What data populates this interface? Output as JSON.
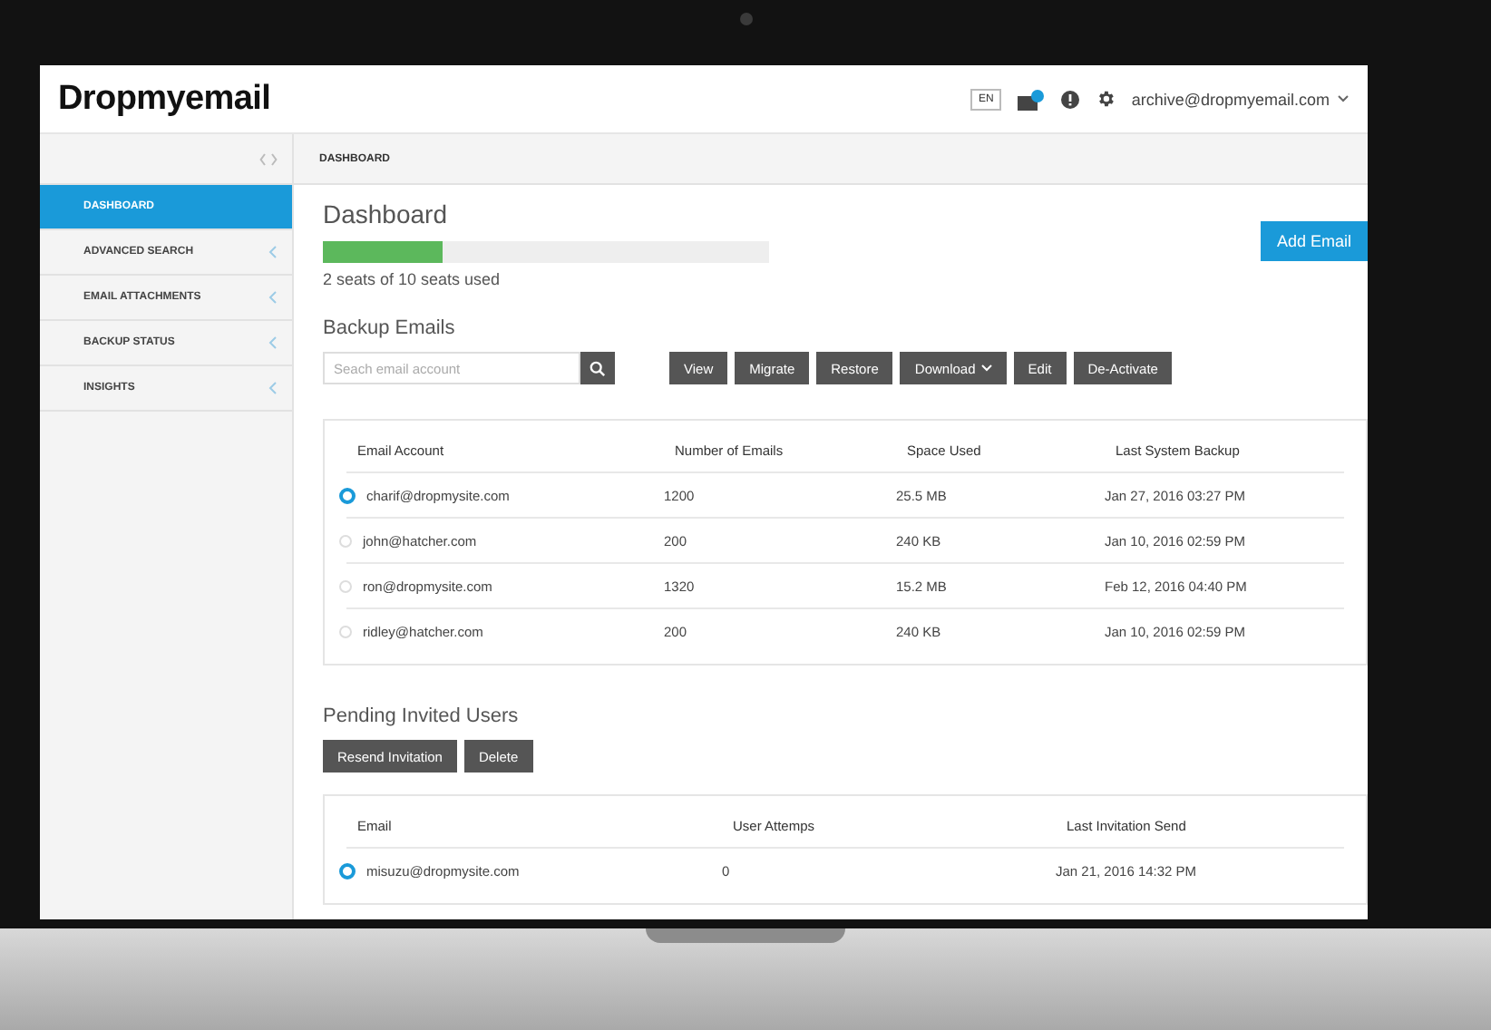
{
  "header": {
    "logo": "Dropmyemail",
    "language": "EN",
    "account": "archive@dropmyemail.com"
  },
  "sidebar": {
    "items": [
      {
        "label": "DASHBOARD",
        "selected": true,
        "expandable": false
      },
      {
        "label": "ADVANCED SEARCH",
        "selected": false,
        "expandable": true
      },
      {
        "label": "EMAIL ATTACHMENTS",
        "selected": false,
        "expandable": true
      },
      {
        "label": "BACKUP STATUS",
        "selected": false,
        "expandable": true
      },
      {
        "label": "INSIGHTS",
        "selected": false,
        "expandable": true
      }
    ]
  },
  "breadcrumb": "DASHBOARD",
  "dashboard": {
    "title": "Dashboard",
    "seats": {
      "level": 0.27,
      "label": "2 seats of 10 seats used"
    },
    "add_button": "Add Email"
  },
  "backup": {
    "title": "Backup Emails",
    "search": {
      "placeholder": "Seach email account"
    },
    "actions": [
      {
        "label": "View",
        "kind": "plain"
      },
      {
        "label": "Migrate",
        "kind": "plain"
      },
      {
        "label": "Restore",
        "kind": "plain"
      },
      {
        "label": "Download",
        "kind": "dropdown"
      },
      {
        "label": "Edit",
        "kind": "plain"
      },
      {
        "label": "De-Activate",
        "kind": "plain"
      }
    ],
    "columns": [
      "Email Account",
      "Number of Emails",
      "Space Used",
      "Last System Backup"
    ],
    "rows": [
      {
        "selected": true,
        "cells": [
          "charif@dropmysite.com",
          "1200",
          "25.5 MB",
          "Jan 27, 2016 03:27 PM"
        ]
      },
      {
        "selected": false,
        "cells": [
          "john@hatcher.com",
          "200",
          "240 KB",
          "Jan 10, 2016 02:59 PM"
        ]
      },
      {
        "selected": false,
        "cells": [
          "ron@dropmysite.com",
          "1320",
          "15.2 MB",
          "Feb 12, 2016 04:40 PM"
        ]
      },
      {
        "selected": false,
        "cells": [
          "ridley@hatcher.com",
          "200",
          "240 KB",
          "Jan 10, 2016 02:59 PM"
        ]
      }
    ]
  },
  "pending": {
    "title": "Pending Invited Users",
    "actions": [
      "Resend Invitation",
      "Delete"
    ],
    "columns": [
      "Email",
      "User Attemps",
      "Last Invitation Send"
    ],
    "rows": [
      {
        "selected": true,
        "cells": [
          "misuzu@dropmysite.com",
          "0",
          "Jan 21, 2016 14:32 PM"
        ]
      }
    ]
  }
}
